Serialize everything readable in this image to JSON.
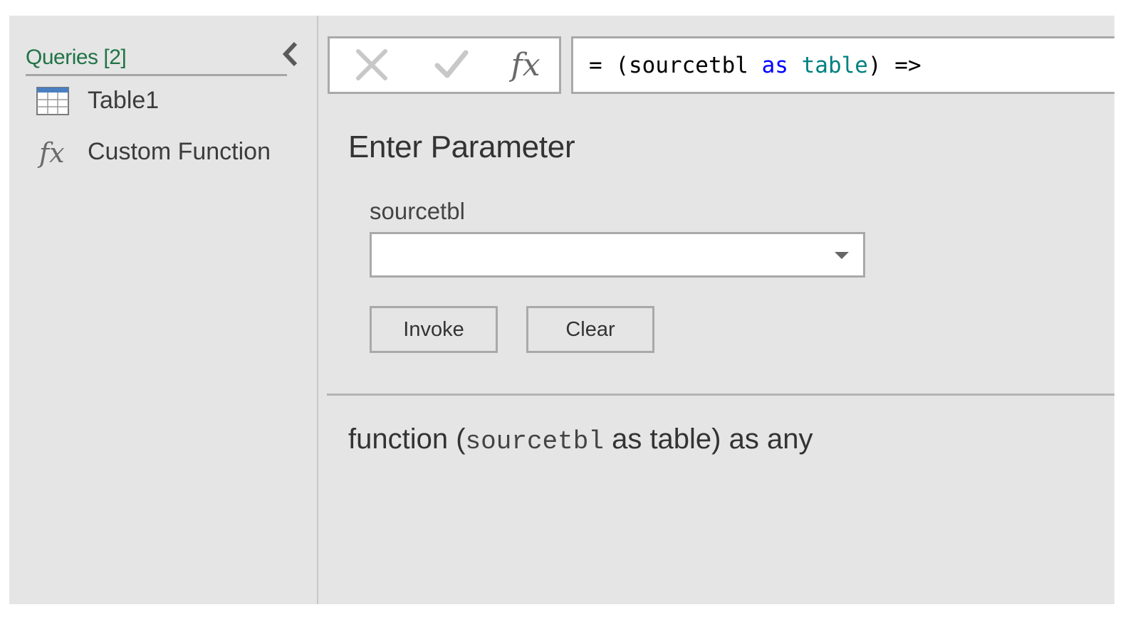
{
  "sidebar": {
    "title": "Queries [2]",
    "collapse_icon": "chevron-left-icon",
    "items": [
      {
        "label": "Table1",
        "icon": "table-icon"
      },
      {
        "label": "Custom Function",
        "icon": "fx-icon",
        "glyph": "fx"
      }
    ]
  },
  "formula_bar": {
    "cancel_icon": "close-icon",
    "commit_icon": "checkmark-icon",
    "fx_label": "fx",
    "tokens": {
      "prefix": "= (sourcetbl ",
      "kw_as": "as",
      "space": " ",
      "kw_table": "table",
      "suffix": ") =>"
    }
  },
  "parameter_panel": {
    "title": "Enter Parameter",
    "param_label": "sourcetbl",
    "param_value": "",
    "dropdown_icon": "chevron-down-icon",
    "invoke_label": "Invoke",
    "clear_label": "Clear"
  },
  "signature": {
    "prefix": "function (",
    "param": "sourcetbl",
    "suffix": " as table) as any"
  },
  "colors": {
    "accent_green": "#217346",
    "keyword_blue": "#0000ff",
    "type_teal": "#008080",
    "table_icon_blue": "#4a7fc1"
  }
}
